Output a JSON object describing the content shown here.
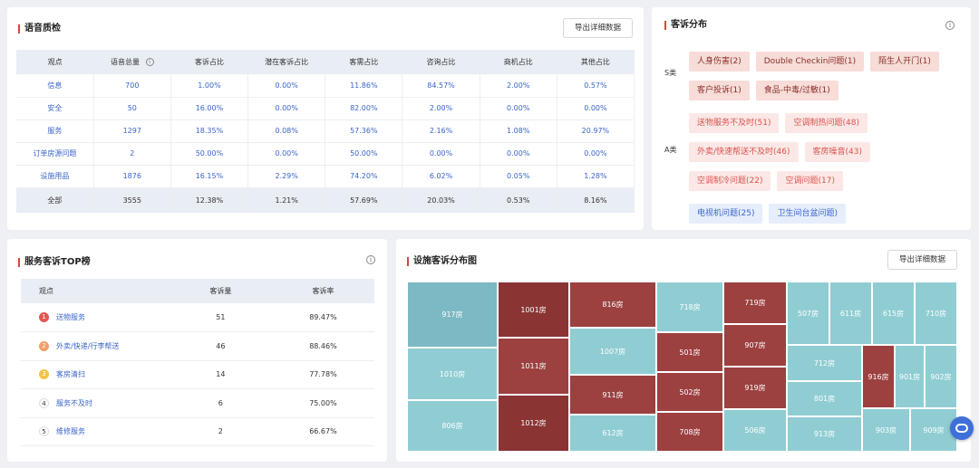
{
  "voice_qc": {
    "title": "语音质检",
    "export_label": "导出详细数据",
    "headers": [
      "观点",
      "语音总量",
      "客诉占比",
      "潜在客诉占比",
      "客需占比",
      "咨询占比",
      "商机占比",
      "其他占比"
    ],
    "rows": [
      [
        "信息",
        "700",
        "1.00%",
        "0.00%",
        "11.86%",
        "84.57%",
        "2.00%",
        "0.57%"
      ],
      [
        "安全",
        "50",
        "16.00%",
        "0.00%",
        "82.00%",
        "2.00%",
        "0.00%",
        "0.00%"
      ],
      [
        "服务",
        "1297",
        "18.35%",
        "0.08%",
        "57.36%",
        "2.16%",
        "1.08%",
        "20.97%"
      ],
      [
        "订单房源问题",
        "2",
        "50.00%",
        "0.00%",
        "50.00%",
        "0.00%",
        "0.00%",
        "0.00%"
      ],
      [
        "设施用品",
        "1876",
        "16.15%",
        "2.29%",
        "74.20%",
        "6.02%",
        "0.05%",
        "1.28%"
      ]
    ],
    "total": [
      "全部",
      "3555",
      "12.38%",
      "1.21%",
      "57.69%",
      "20.03%",
      "0.53%",
      "8.16%"
    ]
  },
  "complaint_dist": {
    "title": "客诉分布",
    "s_label": "S类",
    "a_label": "A类",
    "s_tags": [
      "人身伤害(2)",
      "Double Checkin问题(1)",
      "陌生人开门(1)",
      "客户投诉(1)",
      "食品-中毒/过敏(1)"
    ],
    "a_tags": [
      "送物服务不及时(51)",
      "空调制热问题(48)",
      "外卖/快速帮送不及时(46)",
      "客房噪音(43)",
      "空调制冷问题(22)",
      "空调问题(17)"
    ],
    "b_tags": [
      "电视机问题(25)",
      "卫生间台盆问题)"
    ]
  },
  "top_list": {
    "title": "服务客诉TOP榜",
    "headers": [
      "观点",
      "客诉量",
      "客诉率"
    ],
    "rows": [
      {
        "rank": "1",
        "name": "送物服务",
        "count": "51",
        "rate": "89.47%",
        "color": "#e0574f"
      },
      {
        "rank": "2",
        "name": "外卖/快递/行李帮送",
        "count": "46",
        "rate": "88.46%",
        "color": "#f0a06a"
      },
      {
        "rank": "3",
        "name": "客房清扫",
        "count": "14",
        "rate": "77.78%",
        "color": "#f3c34a"
      },
      {
        "rank": "4",
        "name": "服务不及时",
        "count": "6",
        "rate": "75.00%",
        "color": ""
      },
      {
        "rank": "5",
        "name": "维修服务",
        "count": "2",
        "rate": "66.67%",
        "color": ""
      }
    ]
  },
  "facility_map": {
    "title": "设施客诉分布图",
    "export_label": "导出详细数据",
    "colors": {
      "teal": "#8fcdd3",
      "teal_dark": "#7bb9c4",
      "red": "#9c4040",
      "red_dark": "#8a3434"
    },
    "rooms": [
      "917房",
      "1010房",
      "806房",
      "1001房",
      "1011房",
      "1012房",
      "816房",
      "1007房",
      "911房",
      "612房",
      "718房",
      "501房",
      "502房",
      "708房",
      "719房",
      "907房",
      "919房",
      "506房",
      "507房",
      "611房",
      "615房",
      "710房",
      "712房",
      "801房",
      "913房",
      "916房",
      "901房",
      "902房",
      "903房",
      "909房"
    ]
  }
}
